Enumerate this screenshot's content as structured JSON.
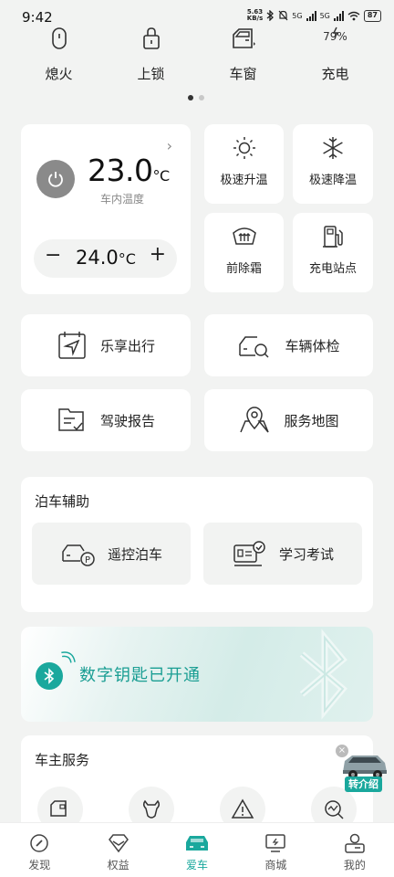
{
  "status_bar": {
    "time": "9:42",
    "net_speed_top": "5.63",
    "net_speed_bottom": "KB/s",
    "signal1": "5G",
    "signal2": "5G",
    "battery": "87"
  },
  "quick_actions": [
    {
      "label": "熄火",
      "icon": "key-fob-icon"
    },
    {
      "label": "上锁",
      "icon": "lock-icon"
    },
    {
      "label": "车窗",
      "icon": "car-window-icon"
    },
    {
      "label": "充电",
      "icon": "battery-charge-icon",
      "value": "79%"
    }
  ],
  "pager": {
    "pages": 2,
    "active": 0
  },
  "climate": {
    "inside_temp": "23.0",
    "unit": "°C",
    "inside_label": "车内温度",
    "set_temp": "24.0",
    "minus": "−",
    "plus": "+"
  },
  "climate_tiles": [
    {
      "label": "极速升温",
      "icon": "sun-icon"
    },
    {
      "label": "极速降温",
      "icon": "snowflake-icon"
    },
    {
      "label": "前除霜",
      "icon": "defrost-icon"
    },
    {
      "label": "充电站点",
      "icon": "charging-station-icon"
    }
  ],
  "feature_cards": [
    {
      "label": "乐享出行",
      "icon": "navigation-icon"
    },
    {
      "label": "车辆体检",
      "icon": "car-check-icon"
    },
    {
      "label": "驾驶报告",
      "icon": "report-icon"
    },
    {
      "label": "服务地图",
      "icon": "map-pin-icon"
    }
  ],
  "parking": {
    "title": "泊车辅助",
    "buttons": [
      {
        "label": "遥控泊车",
        "icon": "remote-parking-icon"
      },
      {
        "label": "学习考试",
        "icon": "certificate-icon"
      }
    ]
  },
  "banner": {
    "text": "数字钥匙已开通",
    "icon": "bluetooth-icon"
  },
  "owner_services": {
    "title": "车主服务",
    "items": [
      {
        "icon": "truck-service-icon"
      },
      {
        "icon": "wrench-icon"
      },
      {
        "icon": "warning-icon"
      },
      {
        "icon": "search-chart-icon"
      }
    ]
  },
  "referral": {
    "label": "转介绍",
    "close": "×"
  },
  "tabs": [
    {
      "label": "发现",
      "icon": "compass-icon",
      "active": false
    },
    {
      "label": "权益",
      "icon": "diamond-icon",
      "active": false
    },
    {
      "label": "爱车",
      "icon": "car-icon",
      "active": true
    },
    {
      "label": "商城",
      "icon": "shop-icon",
      "active": false
    },
    {
      "label": "我的",
      "icon": "profile-icon",
      "active": false
    }
  ],
  "colors": {
    "accent": "#1aa89d",
    "background": "#f2f3f2",
    "card": "#ffffff"
  }
}
